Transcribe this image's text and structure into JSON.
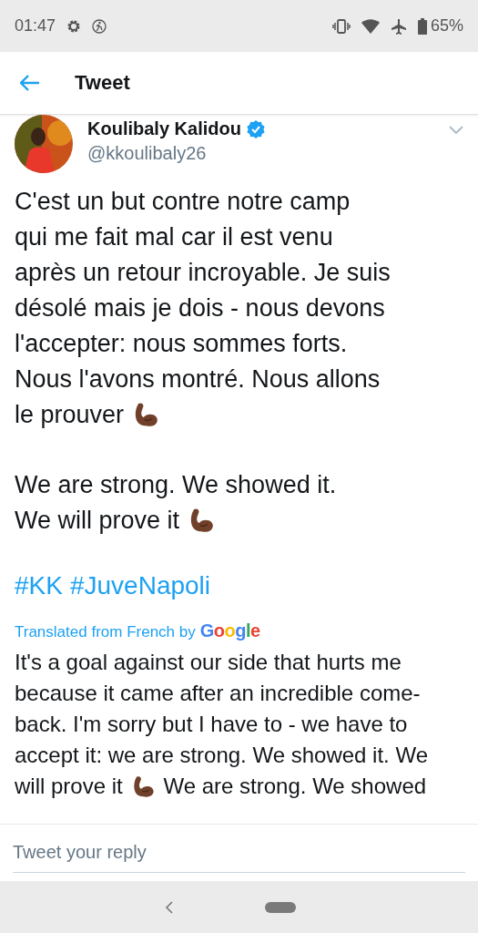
{
  "status_bar": {
    "time": "01:47",
    "battery": "65%"
  },
  "header": {
    "title": "Tweet"
  },
  "author": {
    "name": "Koulibaly Kalidou",
    "handle": "@kkoulibaly26",
    "verified": true
  },
  "tweet": {
    "paragraphs": [
      [
        [
          {
            "kind": "text",
            "text": "C'est un but contre notre camp"
          }
        ],
        [
          {
            "kind": "text",
            "text": "qui me fait mal car il est venu"
          }
        ],
        [
          {
            "kind": "text",
            "text": "après un retour incroyable. Je suis"
          }
        ],
        [
          {
            "kind": "text",
            "text": "désolé mais je dois - nous devons"
          }
        ],
        [
          {
            "kind": "text",
            "text": "l'accepter: nous sommes forts."
          }
        ],
        [
          {
            "kind": "text",
            "text": "Nous l'avons montré. Nous allons"
          }
        ],
        [
          {
            "kind": "text",
            "text": "le prouver"
          },
          {
            "kind": "emoji"
          }
        ]
      ],
      [
        [
          {
            "kind": "text",
            "text": "We are strong. We showed it."
          }
        ],
        [
          {
            "kind": "text",
            "text": "We will prove it"
          },
          {
            "kind": "emoji"
          }
        ]
      ]
    ],
    "hashtags": [
      "#KK",
      "#JuveNapoli"
    ]
  },
  "translation": {
    "label": "Translated from French by",
    "provider": "Google",
    "lines": [
      [
        {
          "kind": "text",
          "text": "It's a goal against our side that hurts me"
        }
      ],
      [
        {
          "kind": "text",
          "text": "because it came after an incredible come-"
        }
      ],
      [
        {
          "kind": "text",
          "text": "back. I'm sorry but I have to - we have to"
        }
      ],
      [
        {
          "kind": "text",
          "text": "accept it: we are strong. We showed it. We"
        }
      ],
      [
        {
          "kind": "text",
          "text": "will prove it"
        },
        {
          "kind": "emoji"
        },
        {
          "kind": "text",
          "text": "We are strong. We showed"
        }
      ]
    ]
  },
  "reply": {
    "placeholder": "Tweet your reply"
  }
}
